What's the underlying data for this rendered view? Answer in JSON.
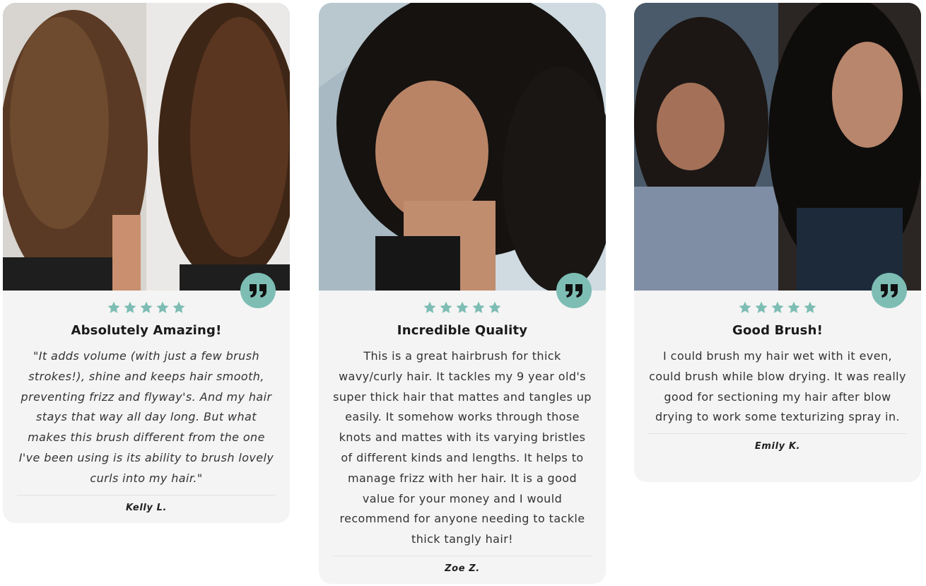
{
  "colors": {
    "accent": "#7dbdb4",
    "card_bg": "#f4f4f4"
  },
  "reviews": [
    {
      "rating": 5,
      "title": "Absolutely Amazing!",
      "text": "\"It adds volume (with just a few brush strokes!), shine and keeps hair smooth, preventing frizz and flyway's. And my hair stays that way all day long. But what makes this brush different from the one I've been using is its ability to brush lovely curls into my hair.\"",
      "author": "Kelly L.",
      "photo": "before-after-curly-hair-back-view",
      "icon": "quote-icon"
    },
    {
      "rating": 5,
      "title": "Incredible Quality",
      "text": "This is a great hairbrush for thick wavy/curly hair. It tackles my 9 year old's super thick hair that mattes and tangles up easily. It somehow works through those knots and mattes with its varying bristles of different kinds and lengths. It helps to manage frizz with her hair. It is a good value for your money and I would recommend for anyone needing to tackle thick tangly hair!",
      "author": "Zoe Z.",
      "photo": "woman-curly-hair-selfie",
      "icon": "quote-icon"
    },
    {
      "rating": 5,
      "title": "Good Brush!",
      "text": "I could brush my hair wet with it even, could brush while blow drying. It was really good for sectioning my hair after blow drying to work some texturizing spray in.",
      "author": "Emily K.",
      "photo": "before-after-curly-hair-portraits",
      "icon": "quote-icon"
    }
  ]
}
